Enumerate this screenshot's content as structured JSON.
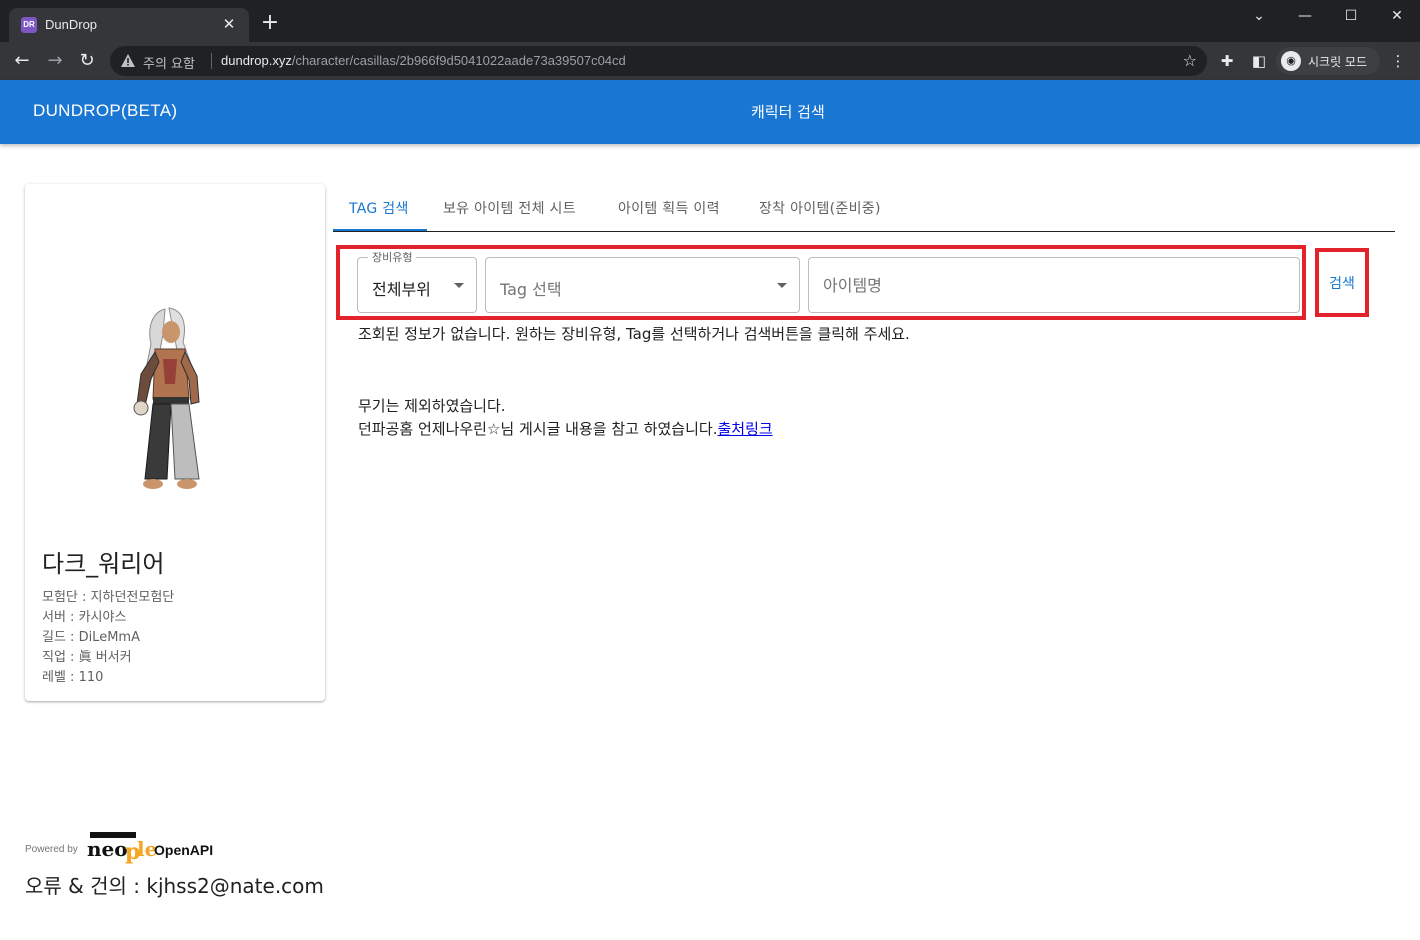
{
  "browser": {
    "tab_title": "DunDrop",
    "favicon_text": "DR",
    "address_warning": "주의 요함",
    "url_domain": "dundrop.xyz",
    "url_path": "/character/casillas/2b966f9d5041022aade73a39507c04cd",
    "profile_label": "시크릿 모드"
  },
  "appbar": {
    "title": "DUNDROP(BETA)",
    "nav_link": "캐릭터 검색",
    "color": "#1976d2"
  },
  "character": {
    "name": "다크_워리어",
    "adventure_group": "모험단 : 지하던전모험단",
    "server": "서버 : 카시야스",
    "guild": "길드 : DiLeMmA",
    "job": "직업 : 眞 버서커",
    "level": "레벨 : 110"
  },
  "tabs": [
    {
      "label": "TAG 검색",
      "active": true
    },
    {
      "label": "보유 아이템 전체 시트",
      "active": false
    },
    {
      "label": "아이템 획득 이력",
      "active": false
    },
    {
      "label": "장착 아이템(준비중)",
      "active": false
    }
  ],
  "search": {
    "equip_type_legend": "장비유형",
    "equip_type_value": "전체부위",
    "tag_placeholder": "Tag 선택",
    "item_name_placeholder": "아이템명",
    "button_label": "검색"
  },
  "messages": {
    "no_result": "조회된 정보가 없습니다. 원하는 장비유형, Tag를 선택하거나 검색버튼을 클릭해 주세요.",
    "weapon_excluded": "무기는 제외하였습니다.",
    "reference": "던파공홈 언제나우린☆님 게시글 내용을 참고 하였습니다.",
    "source_link": "출처링크"
  },
  "footer": {
    "powered_by": "Powered by",
    "openapi_label": "OpenAPI",
    "contact": "오류 & 건의 : kjhss2@nate.com"
  }
}
